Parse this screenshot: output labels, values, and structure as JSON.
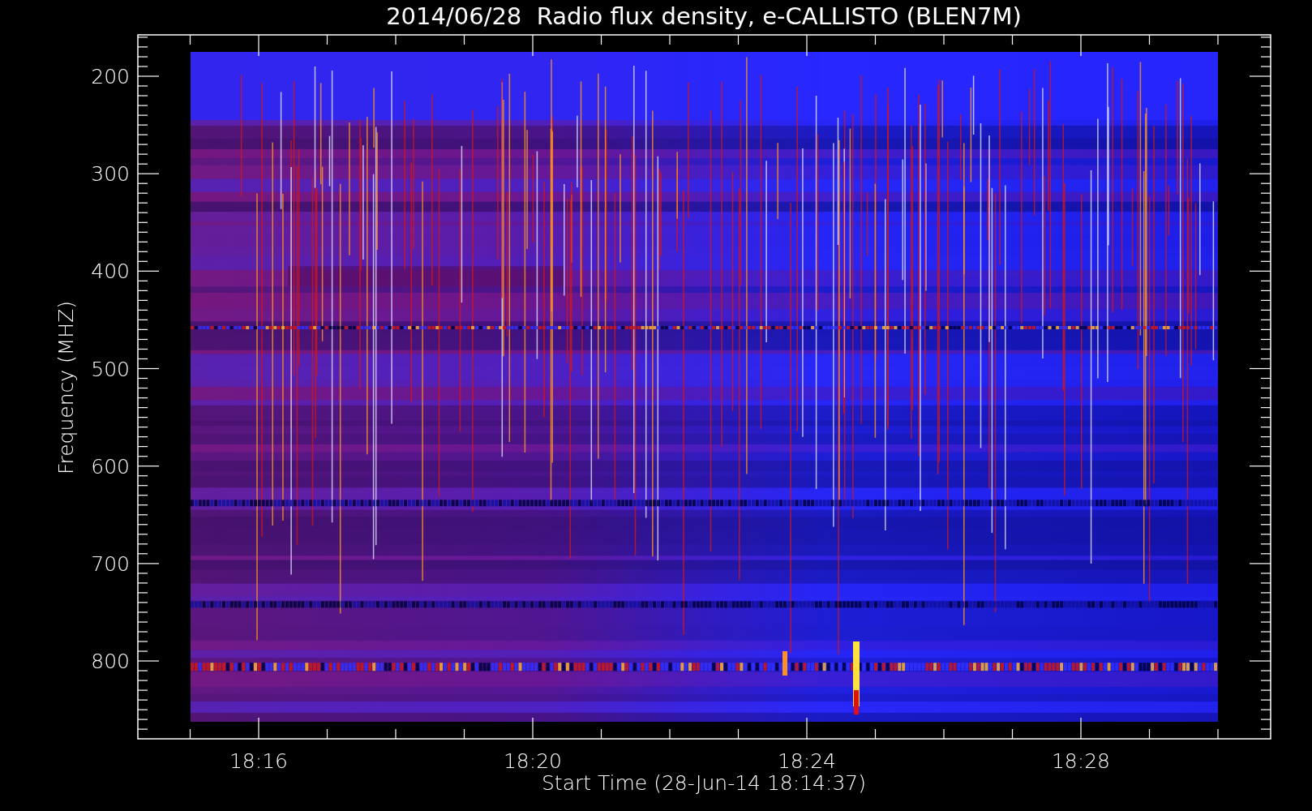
{
  "title": "2014/06/28  Radio flux density, e-CALLISTO (BLEN7M)",
  "y_axis": {
    "label": "Frequency (MHZ)",
    "ticks": [
      "200",
      "300",
      "400",
      "500",
      "600",
      "700",
      "800"
    ]
  },
  "x_axis": {
    "label": "Start Time (28-Jun-14 18:14:37)",
    "ticks": [
      "18:16",
      "18:20",
      "18:24",
      "18:28"
    ]
  }
}
